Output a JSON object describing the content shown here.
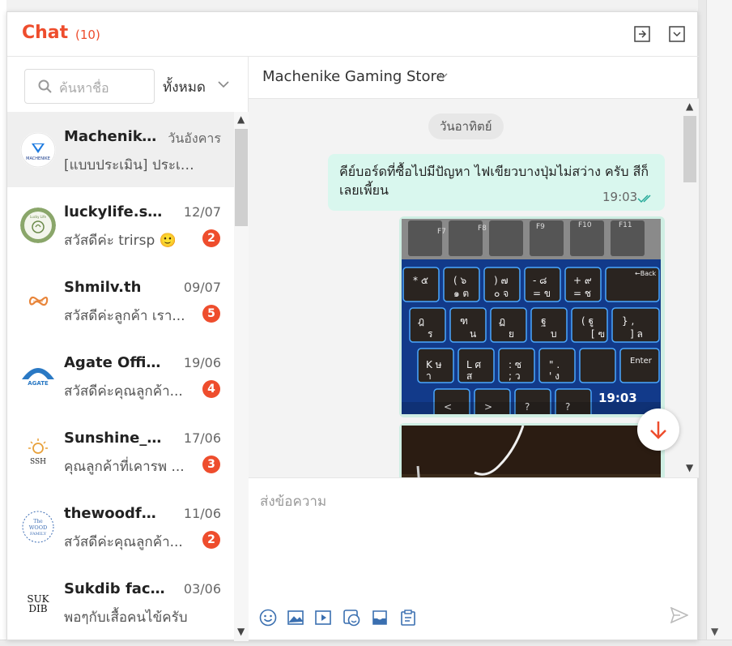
{
  "header": {
    "title": "Chat",
    "count": "(10)"
  },
  "search": {
    "placeholder": "ค้นหาชื่อ",
    "filter_label": "ทั้งหมด"
  },
  "conversations": [
    {
      "name": "Machenike G...",
      "date": "วันอังคาร",
      "preview": "[แบบประเมิน] ประเมิน...",
      "badge": "",
      "avatar": "machenike-logo"
    },
    {
      "name": "luckylife.shop",
      "date": "12/07",
      "preview": "สวัสดีค่ะ trirsp 🙂",
      "badge": "2",
      "avatar": "luckylife-logo"
    },
    {
      "name": "Shmilv.th",
      "date": "09/07",
      "preview": "สวัสดีค่ะลูกค้า เรา...",
      "badge": "5",
      "avatar": "shmilv-logo"
    },
    {
      "name": "Agate Official ...",
      "date": "19/06",
      "preview": "สวัสดีค่ะคุณลูกค้า...",
      "badge": "4",
      "avatar": "agate-logo"
    },
    {
      "name": "Sunshine_Hom...",
      "date": "17/06",
      "preview": "คุณลูกค้าที่เคารพ ...",
      "badge": "3",
      "avatar": "sunshine-logo"
    },
    {
      "name": "thewoodfamily...",
      "date": "11/06",
      "preview": "สวัสดีค่ะคุณลูกค้า...",
      "badge": "2",
      "avatar": "woodfamily-logo"
    },
    {
      "name": "Sukdib factory",
      "date": "03/06",
      "preview": "พอๆกับเสื้อคนไข้ครับ",
      "badge": "",
      "avatar": "sukdib-logo"
    }
  ],
  "active_chat": {
    "store_name": "Machenike Gaming Store",
    "day_label": "วันอาทิตย์",
    "messages": [
      {
        "type": "text",
        "text": "คีย์บอร์ดที่ซื้อไปมีปัญหา ไฟเขียวบางปุ่มไม่สว่าง ครับ สีก็เลยเพี้ยน",
        "time": "19:03"
      },
      {
        "type": "image",
        "time": "19:03"
      },
      {
        "type": "image",
        "time": ""
      }
    ]
  },
  "composer": {
    "placeholder": "ส่งข้อความ"
  },
  "colors": {
    "accent": "#ee4d2d",
    "bubble": "#d9f7ee",
    "tick": "#26aa99"
  }
}
